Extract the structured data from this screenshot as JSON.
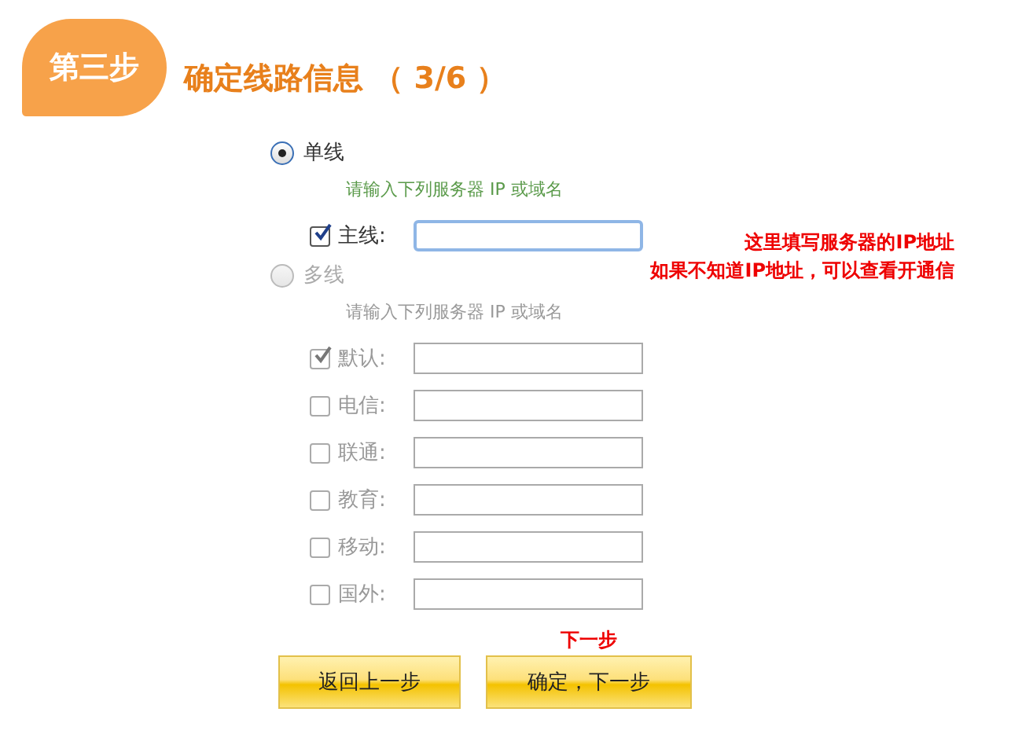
{
  "step_badge": "第三步",
  "title": "确定线路信息 （ 3/6 ）",
  "options": [
    {
      "label": "单线",
      "selected": true,
      "disabled": false,
      "hint": "请输入下列服务器 IP 或域名",
      "lines": [
        {
          "label": "主线:",
          "checked": true,
          "focused": true
        }
      ]
    },
    {
      "label": "多线",
      "selected": false,
      "disabled": true,
      "hint": "请输入下列服务器 IP 或域名",
      "lines": [
        {
          "label": "默认:",
          "checked": true,
          "focused": false
        },
        {
          "label": "电信:",
          "checked": false,
          "focused": false
        },
        {
          "label": "联通:",
          "checked": false,
          "focused": false
        },
        {
          "label": "教育:",
          "checked": false,
          "focused": false
        },
        {
          "label": "移动:",
          "checked": false,
          "focused": false
        },
        {
          "label": "国外:",
          "checked": false,
          "focused": false
        }
      ]
    }
  ],
  "annotation": [
    "这里填写服务器的IP地址",
    "如果不知道IP地址，可以查看开通信"
  ],
  "buttons": [
    {
      "label": "返回上一步"
    },
    {
      "label": "确定，下一步",
      "note": "下一步"
    }
  ]
}
